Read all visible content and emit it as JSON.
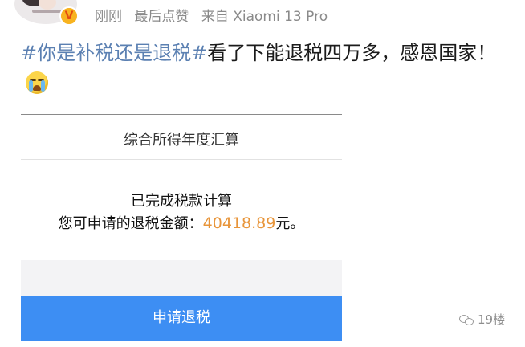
{
  "post_header": {
    "time": "刚刚",
    "edit_note": "最后点赞",
    "source": "来自 Xiaomi 13 Pro",
    "verified_badge": "V"
  },
  "post": {
    "hashtag": "#你是补税还是退税#",
    "text": "看了下能退税四万多，感恩国家！",
    "emoji": "crying-face-emoji"
  },
  "tax_card": {
    "title": "综合所得年度汇算",
    "status": "已完成税款计算",
    "refund_label": "您可申请的退税金额：",
    "refund_amount": "40418.89",
    "refund_unit": "元。",
    "button_label": "申请退税"
  },
  "watermark": {
    "text": "19楼",
    "icon": "wechat-icon"
  },
  "colors": {
    "hashtag": "#5b80b2",
    "amount": "#e8953a",
    "button": "#3d8ef3"
  }
}
